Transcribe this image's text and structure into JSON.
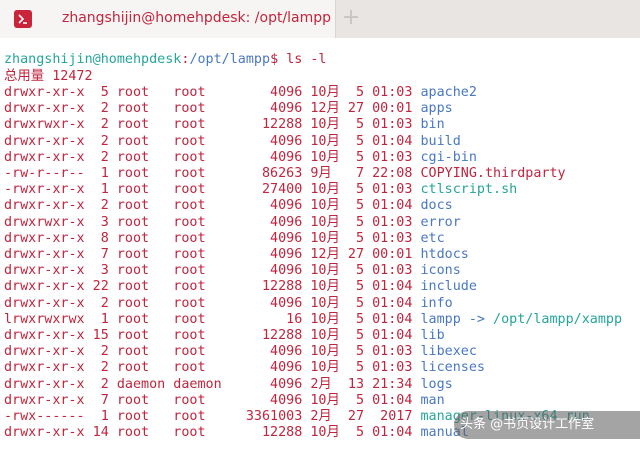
{
  "window": {
    "tab_title": "zhangshijin@homehpdesk: /opt/lampp",
    "new_tab_symbol": "+"
  },
  "prompt": {
    "user_host": "zhangshijin@homehpdesk",
    "separator": ":",
    "path": "/opt/lampp",
    "suffix": "$ ",
    "command": "ls -l"
  },
  "total_line": "总用量 12472",
  "listing": [
    {
      "perms": "drwxr-xr-x",
      "links": "5",
      "owner": "root",
      "group": "root",
      "size": "4096",
      "month": "10月",
      "day": "5",
      "time": "01:03",
      "name": "apache2",
      "kind": "dir"
    },
    {
      "perms": "drwxr-xr-x",
      "links": "2",
      "owner": "root",
      "group": "root",
      "size": "4096",
      "month": "12月",
      "day": "27",
      "time": "00:01",
      "name": "apps",
      "kind": "dir"
    },
    {
      "perms": "drwxrwxr-x",
      "links": "2",
      "owner": "root",
      "group": "root",
      "size": "12288",
      "month": "10月",
      "day": "5",
      "time": "01:03",
      "name": "bin",
      "kind": "dir"
    },
    {
      "perms": "drwxr-xr-x",
      "links": "2",
      "owner": "root",
      "group": "root",
      "size": "4096",
      "month": "10月",
      "day": "5",
      "time": "01:04",
      "name": "build",
      "kind": "dir"
    },
    {
      "perms": "drwxr-xr-x",
      "links": "2",
      "owner": "root",
      "group": "root",
      "size": "4096",
      "month": "10月",
      "day": "5",
      "time": "01:03",
      "name": "cgi-bin",
      "kind": "dir"
    },
    {
      "perms": "-rw-r--r--",
      "links": "1",
      "owner": "root",
      "group": "root",
      "size": "86263",
      "month": "9月",
      "day": "7",
      "time": "22:08",
      "name": "COPYING.thirdparty",
      "kind": "file"
    },
    {
      "perms": "-rwxr-xr-x",
      "links": "1",
      "owner": "root",
      "group": "root",
      "size": "27400",
      "month": "10月",
      "day": "5",
      "time": "01:03",
      "name": "ctlscript.sh",
      "kind": "exe"
    },
    {
      "perms": "drwxr-xr-x",
      "links": "2",
      "owner": "root",
      "group": "root",
      "size": "4096",
      "month": "10月",
      "day": "5",
      "time": "01:04",
      "name": "docs",
      "kind": "dir"
    },
    {
      "perms": "drwxrwxr-x",
      "links": "3",
      "owner": "root",
      "group": "root",
      "size": "4096",
      "month": "10月",
      "day": "5",
      "time": "01:03",
      "name": "error",
      "kind": "dir"
    },
    {
      "perms": "drwxr-xr-x",
      "links": "8",
      "owner": "root",
      "group": "root",
      "size": "4096",
      "month": "10月",
      "day": "5",
      "time": "01:03",
      "name": "etc",
      "kind": "dir"
    },
    {
      "perms": "drwxr-xr-x",
      "links": "7",
      "owner": "root",
      "group": "root",
      "size": "4096",
      "month": "12月",
      "day": "27",
      "time": "00:01",
      "name": "htdocs",
      "kind": "dir"
    },
    {
      "perms": "drwxr-xr-x",
      "links": "3",
      "owner": "root",
      "group": "root",
      "size": "4096",
      "month": "10月",
      "day": "5",
      "time": "01:03",
      "name": "icons",
      "kind": "dir"
    },
    {
      "perms": "drwxr-xr-x",
      "links": "22",
      "owner": "root",
      "group": "root",
      "size": "12288",
      "month": "10月",
      "day": "5",
      "time": "01:04",
      "name": "include",
      "kind": "dir"
    },
    {
      "perms": "drwxr-xr-x",
      "links": "2",
      "owner": "root",
      "group": "root",
      "size": "4096",
      "month": "10月",
      "day": "5",
      "time": "01:04",
      "name": "info",
      "kind": "dir"
    },
    {
      "perms": "lrwxrwxrwx",
      "links": "1",
      "owner": "root",
      "group": "root",
      "size": "16",
      "month": "10月",
      "day": "5",
      "time": "01:04",
      "name": "lampp",
      "kind": "link",
      "arrow": " -> ",
      "target": "/opt/lampp/xampp"
    },
    {
      "perms": "drwxr-xr-x",
      "links": "15",
      "owner": "root",
      "group": "root",
      "size": "12288",
      "month": "10月",
      "day": "5",
      "time": "01:04",
      "name": "lib",
      "kind": "dir"
    },
    {
      "perms": "drwxr-xr-x",
      "links": "2",
      "owner": "root",
      "group": "root",
      "size": "4096",
      "month": "10月",
      "day": "5",
      "time": "01:03",
      "name": "libexec",
      "kind": "dir"
    },
    {
      "perms": "drwxr-xr-x",
      "links": "2",
      "owner": "root",
      "group": "root",
      "size": "4096",
      "month": "10月",
      "day": "5",
      "time": "01:03",
      "name": "licenses",
      "kind": "dir"
    },
    {
      "perms": "drwxr-xr-x",
      "links": "2",
      "owner": "daemon",
      "group": "daemon",
      "size": "4096",
      "month": "2月",
      "day": "13",
      "time": "21:34",
      "name": "logs",
      "kind": "dir"
    },
    {
      "perms": "drwxr-xr-x",
      "links": "7",
      "owner": "root",
      "group": "root",
      "size": "4096",
      "month": "10月",
      "day": "5",
      "time": "01:04",
      "name": "man",
      "kind": "dir"
    },
    {
      "perms": "-rwx------",
      "links": "1",
      "owner": "root",
      "group": "root",
      "size": "3361003",
      "month": "2月",
      "day": "27",
      "time": "2017",
      "name": "manager-linux-x64.run",
      "kind": "exe"
    },
    {
      "perms": "drwxr-xr-x",
      "links": "14",
      "owner": "root",
      "group": "root",
      "size": "12288",
      "month": "10月",
      "day": "5",
      "time": "01:04",
      "name": "manual",
      "kind": "dir"
    }
  ],
  "watermark": {
    "text": "头条 @书页设计工作室"
  },
  "colors": {
    "accent": "#c0253e",
    "user_host": "#26a69a",
    "directory": "#4a78c2",
    "executable": "#26a69a",
    "titlebar": "#e9e5e2"
  }
}
